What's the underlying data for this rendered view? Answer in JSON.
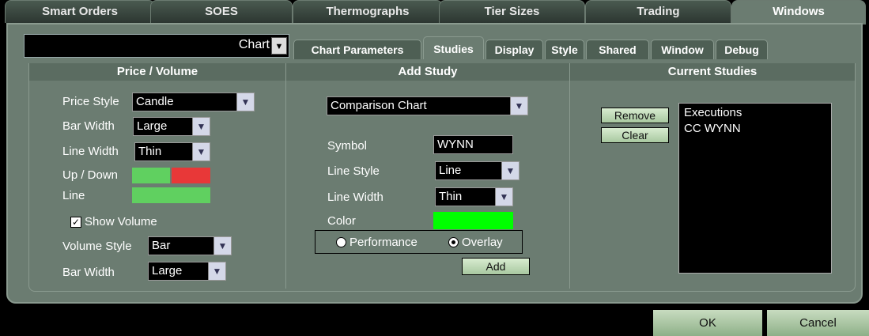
{
  "top_tabs": [
    "Smart Orders",
    "SOES",
    "Thermographs",
    "Tier Sizes",
    "Trading",
    "Windows"
  ],
  "chart_selector": "Chart",
  "sub_tabs": [
    "Chart Parameters",
    "Studies",
    "Display",
    "Style",
    "Shared",
    "Window",
    "Debug"
  ],
  "price_volume": {
    "title": "Price / Volume",
    "price_style_label": "Price Style",
    "price_style_value": "Candle",
    "bar_width_label": "Bar Width",
    "bar_width_value": "Large",
    "line_width_label": "Line Width",
    "line_width_value": "Thin",
    "updown_label": "Up / Down",
    "line_label": "Line",
    "show_volume_label": "Show Volume",
    "volume_style_label": "Volume Style",
    "volume_style_value": "Bar",
    "bar_width2_label": "Bar Width",
    "bar_width2_value": "Large",
    "colors": {
      "up": "#60d060",
      "down": "#e83838",
      "line": "#60d060"
    }
  },
  "add_study": {
    "title": "Add Study",
    "study_type": "Comparison Chart",
    "symbol_label": "Symbol",
    "symbol_value": "WYNN",
    "line_style_label": "Line Style",
    "line_style_value": "Line",
    "line_width_label": "Line Width",
    "line_width_value": "Thin",
    "color_label": "Color",
    "color_value": "#00ff00",
    "performance_label": "Performance",
    "overlay_label": "Overlay",
    "add_label": "Add"
  },
  "current_studies": {
    "title": "Current Studies",
    "remove_label": "Remove",
    "clear_label": "Clear",
    "items": [
      "Executions",
      "CC WYNN"
    ]
  },
  "footer": {
    "ok_label": "OK",
    "cancel_label": "Cancel"
  }
}
